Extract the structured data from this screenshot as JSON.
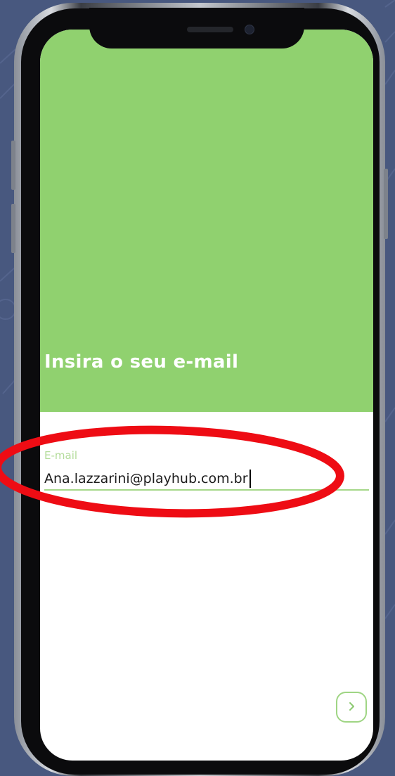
{
  "screen": {
    "title": "Insira o seu e-mail",
    "email_field": {
      "label": "E-mail",
      "value": "Ana.lazzarini@playhub.com.br"
    },
    "next_button": {
      "icon": "chevron-right-icon"
    }
  },
  "colors": {
    "hero_green": "#90d16f",
    "field_label": "#b3dc9a",
    "field_underline": "#a5d88a",
    "annotation_red": "#ee0c14",
    "background": "#48587f"
  }
}
